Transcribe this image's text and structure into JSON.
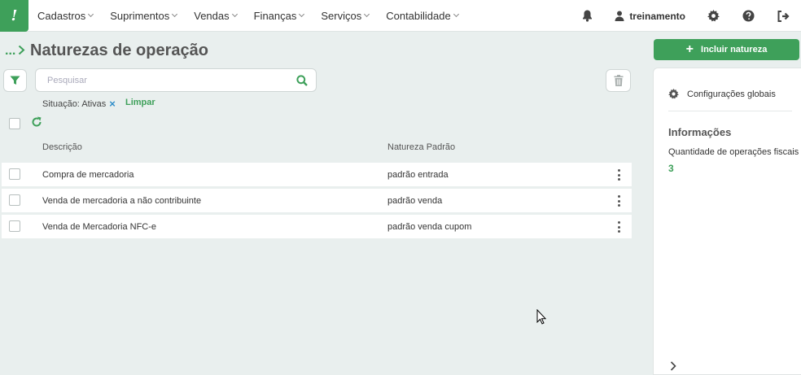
{
  "nav": {
    "logo_text": "!",
    "menu": [
      "Cadastros",
      "Suprimentos",
      "Vendas",
      "Finanças",
      "Serviços",
      "Contabilidade"
    ],
    "user_name": "treinamento",
    "icons": [
      "bell-icon",
      "user-icon",
      "gear-icon",
      "help-icon",
      "logout-icon"
    ]
  },
  "header": {
    "breadcrumb_dots": "...",
    "title": "Naturezas de operação"
  },
  "toolbar": {
    "search_placeholder": "Pesquisar",
    "search_value": ""
  },
  "filters": {
    "tag_label": "Situação: Ativas",
    "tag_remove": "×",
    "clear_label": "Limpar"
  },
  "table": {
    "columns": [
      "Descrição",
      "Natureza Padrão"
    ],
    "rows": [
      {
        "descricao": "Compra de mercadoria",
        "natureza": "padrão entrada"
      },
      {
        "descricao": "Venda de mercadoria a não contribuinte",
        "natureza": "padrão venda"
      },
      {
        "descricao": "Venda de Mercadoria NFC-e",
        "natureza": "padrão venda cupom"
      }
    ]
  },
  "side": {
    "include_label": "Incluir natureza",
    "config_label": "Configurações globais",
    "info_title": "Informações",
    "info_label": "Quantidade de operações fiscais",
    "info_value": "3"
  },
  "colors": {
    "accent": "#3ea05a",
    "background": "#e9efee"
  }
}
